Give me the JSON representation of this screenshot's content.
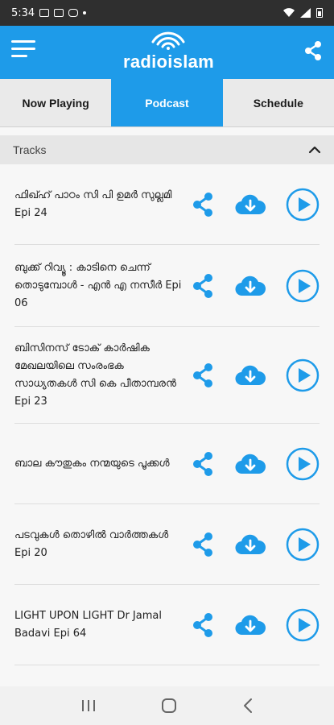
{
  "status": {
    "time": "5:34"
  },
  "app": {
    "logo_text": "radioislam"
  },
  "tabs": [
    {
      "label": "Now Playing"
    },
    {
      "label": "Podcast"
    },
    {
      "label": "Schedule"
    }
  ],
  "section": {
    "title": "Tracks"
  },
  "tracks": [
    {
      "title": "ഫിഖ്ഹ് പാഠം സി പി ഉമർ സുല്ലമി Epi 24"
    },
    {
      "title": "ബുക്ക് റിവ്യൂ : കാടിനെ ചെന്ന് തൊടുമ്പോൾ - എൻ എ നസീർ Epi 06"
    },
    {
      "title": "ബിസിനസ് ടോക് കാർഷിക മേഖലയിലെ സംരംഭക സാധ്യതകൾ സി കെ പീതാമ്പരൻ  Epi 23"
    },
    {
      "title": "ബാല കൗതുകം  നന്മയുടെ പൂക്കൾ"
    },
    {
      "title": "പടവുകൾ  തൊഴിൽ വാർത്തകൾ  Epi 20"
    },
    {
      "title": "LIGHT UPON LIGHT  Dr Jamal Badavi Epi 64"
    }
  ],
  "colors": {
    "accent": "#1e9be9"
  }
}
